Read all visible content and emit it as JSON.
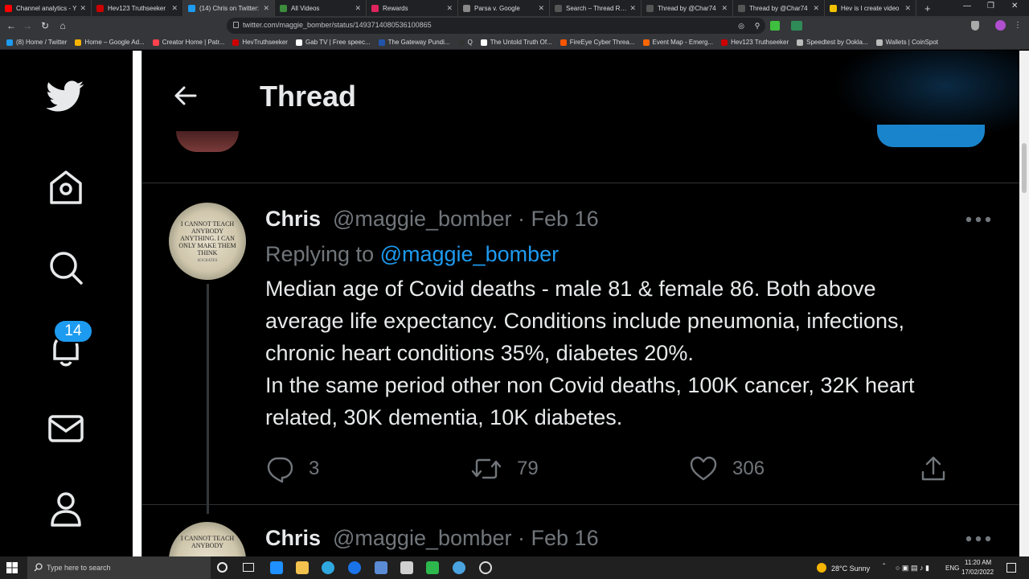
{
  "browser": {
    "tabs": [
      {
        "label": "Channel analytics - Y",
        "color": "#ff0000"
      },
      {
        "label": "Hev123 Truthseeker",
        "color": "#cc0000"
      },
      {
        "label": "(14) Chris on Twitter:",
        "color": "#1d9bf0",
        "active": true
      },
      {
        "label": "All Videos",
        "color": "#3d8b3d"
      },
      {
        "label": "Rewards",
        "color": "#e0245e"
      },
      {
        "label": "Parsa v. Google",
        "color": "#888888"
      },
      {
        "label": "Search – Thread Rea",
        "color": "#555555"
      },
      {
        "label": "Thread by @Char74",
        "color": "#555555"
      },
      {
        "label": "Thread by @Char74",
        "color": "#555555"
      },
      {
        "label": "Hev is I create video",
        "color": "#f2c200"
      }
    ],
    "url": "twitter.com/maggie_bomber/status/1493714080536100865",
    "bookmarks": [
      {
        "label": "(8) Home / Twitter",
        "color": "#1d9bf0"
      },
      {
        "label": "Home – Google Ad...",
        "color": "#f4b400"
      },
      {
        "label": "Creator Home | Patr...",
        "color": "#ff424d"
      },
      {
        "label": "HevTruthseeker",
        "color": "#cc0000"
      },
      {
        "label": "Gab TV | Free speec...",
        "color": "#ffffff"
      },
      {
        "label": "The Gateway Pundi...",
        "color": "#2255aa"
      },
      {
        "label": "Q",
        "color": "#333333"
      },
      {
        "label": "The Untold Truth Of...",
        "color": "#ffffff"
      },
      {
        "label": "FireEye Cyber Threa...",
        "color": "#ff5500"
      },
      {
        "label": "Event Map - Emerg...",
        "color": "#ff6600"
      },
      {
        "label": "Hev123 Truthseeker",
        "color": "#cc0000"
      },
      {
        "label": "Speedtest by Ookla...",
        "color": "#bbbbbb"
      },
      {
        "label": "Wallets | CoinSpot",
        "color": "#bbbbbb"
      }
    ]
  },
  "twitter": {
    "header_title": "Thread",
    "notification_count": "14",
    "tweets": [
      {
        "name": "Chris",
        "handle_date": "@maggie_bomber · Feb 16",
        "replying_prefix": "Replying to ",
        "replying_handle": "@maggie_bomber",
        "avatar_text": "I CANNOT TEACH ANYBODY ANYTHING. I CAN ONLY MAKE THEM THINK",
        "avatar_sub": "SOCRATES",
        "body": [
          "Median age of Covid deaths - male 81 & female 86. Both above",
          "average life expectancy. Conditions include pneumonia, infections,",
          "chronic heart conditions 35%, diabetes 20%.",
          "In the same period other non Covid deaths, 100K cancer, 32K heart",
          "related, 30K dementia, 10K diabetes."
        ],
        "replies": "3",
        "retweets": "79",
        "likes": "306"
      },
      {
        "name": "Chris",
        "handle_date": "@maggie_bomber · Feb 16",
        "avatar_text": "I CANNOT TEACH ANYBODY"
      }
    ]
  },
  "taskbar": {
    "search_placeholder": "Type here to search",
    "weather": "28°C Sunny",
    "language": "ENG",
    "time": "11:20 AM",
    "date": "17/02/2022"
  },
  "colors": {
    "accent": "#1d9bf0",
    "text_primary": "#e7e9ea",
    "text_secondary": "#71767b",
    "background": "#000000"
  }
}
